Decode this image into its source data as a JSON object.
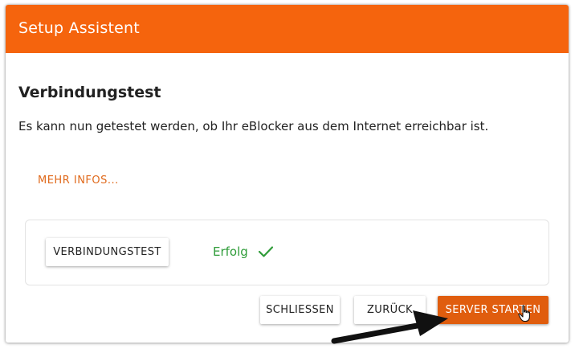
{
  "dialog": {
    "title": "Setup Assistent",
    "step_title": "Verbindungstest",
    "description": "Es kann nun getestet werden, ob Ihr eBlocker aus dem Internet erreichbar ist.",
    "more_info_link": "MEHR INFOS..."
  },
  "test_card": {
    "test_button_label": "VERBINDUNGSTEST",
    "result_text": "Erfolg",
    "result_icon": "checkmark-icon",
    "result_color": "#2f9c39"
  },
  "footer": {
    "close_label": "SCHLIESSEN",
    "back_label": "ZURÜCK",
    "start_label": "SERVER STARTEN"
  },
  "colors": {
    "header": "#f5640d",
    "accent": "#e05d0e",
    "link": "#e06a1c"
  },
  "overlay": {
    "pointer_icon": "hand-pointer-icon",
    "annotation_icon": "black-arrow-icon"
  }
}
